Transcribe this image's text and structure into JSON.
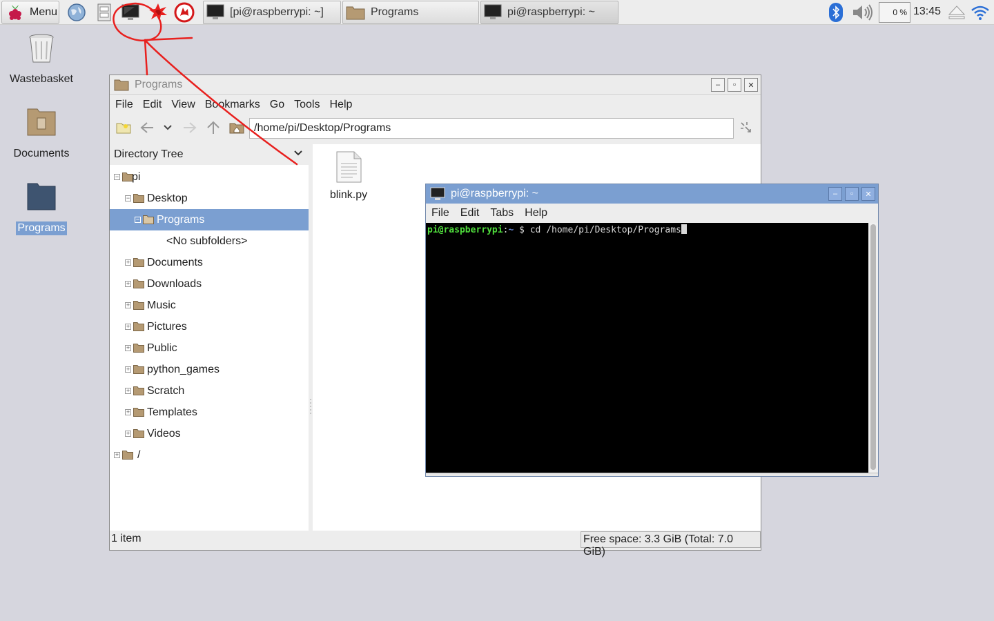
{
  "taskbar": {
    "menu_label": "Menu",
    "launchers": [
      "web-browser",
      "file-manager",
      "terminal",
      "mathematica",
      "wolfram"
    ],
    "tasks": [
      {
        "label": "[pi@raspberrypi: ~]",
        "icon": "terminal-icon"
      },
      {
        "label": "Programs",
        "icon": "folder-icon"
      },
      {
        "label": "pi@raspberrypi: ~",
        "icon": "terminal-icon"
      }
    ],
    "cpu_usage": "0 %",
    "clock": "13:45"
  },
  "desktop": {
    "icons": [
      {
        "label": "Wastebasket"
      },
      {
        "label": "Documents"
      },
      {
        "label": "Programs",
        "selected": true
      }
    ]
  },
  "file_manager": {
    "title": "Programs",
    "menu": [
      "File",
      "Edit",
      "View",
      "Bookmarks",
      "Go",
      "Tools",
      "Help"
    ],
    "path": "/home/pi/Desktop/Programs",
    "side_pane_title": "Directory Tree",
    "tree": [
      {
        "label": "pi",
        "expander": "−"
      },
      {
        "label": "Desktop",
        "expander": "−"
      },
      {
        "label": "Programs",
        "expander": "−",
        "selected": true
      },
      {
        "label": "<No subfolders>"
      },
      {
        "label": "Documents",
        "expander": "+"
      },
      {
        "label": "Downloads",
        "expander": "+"
      },
      {
        "label": "Music",
        "expander": "+"
      },
      {
        "label": "Pictures",
        "expander": "+"
      },
      {
        "label": "Public",
        "expander": "+"
      },
      {
        "label": "python_games",
        "expander": "+"
      },
      {
        "label": "Scratch",
        "expander": "+"
      },
      {
        "label": "Templates",
        "expander": "+"
      },
      {
        "label": "Videos",
        "expander": "+"
      },
      {
        "label": "/",
        "expander": "+"
      }
    ],
    "files": [
      {
        "name": "blink.py"
      }
    ],
    "status_left": "1 item",
    "status_right": "Free space: 3.3 GiB (Total: 7.0 GiB)"
  },
  "terminal": {
    "title": "pi@raspberrypi: ~",
    "menu": [
      "File",
      "Edit",
      "Tabs",
      "Help"
    ],
    "prompt_user": "pi@raspberrypi",
    "prompt_sep": ":",
    "prompt_dir": "~",
    "prompt_symbol": " $ ",
    "command": "cd /home/pi/Desktop/Programs"
  },
  "colors": {
    "desktop_bg": "#d6d6de",
    "selection": "#7b9fd1",
    "annotation": "#e8201e",
    "prompt_user": "#4fdc3c"
  }
}
